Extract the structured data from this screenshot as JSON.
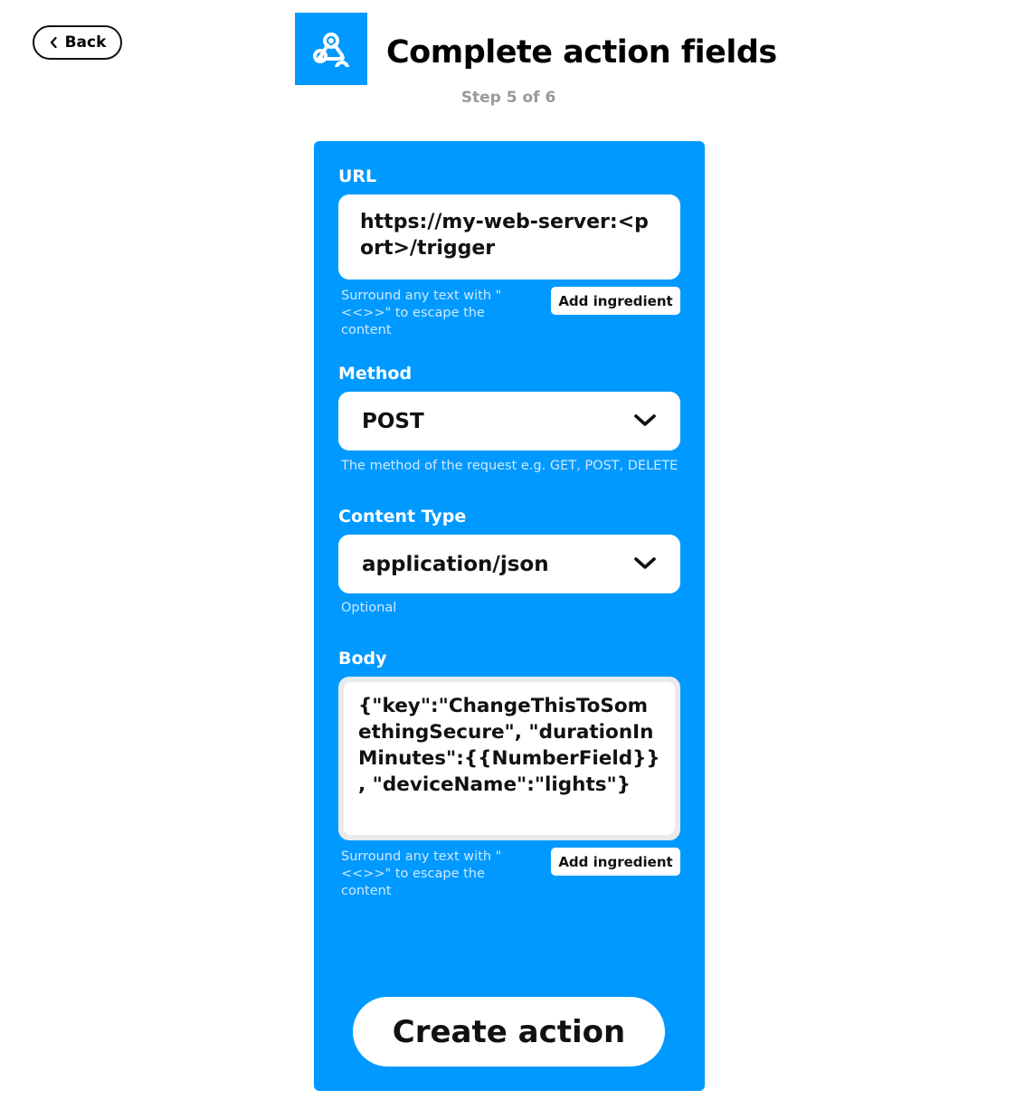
{
  "header": {
    "back_label": "Back",
    "title": "Complete action fields",
    "step": "Step 5 of 6",
    "logo_icon": "webhooks-icon",
    "brand_color": "#0099ff"
  },
  "form": {
    "url": {
      "label": "URL",
      "value": "https://my-web-server:<port>/trigger",
      "helper": "Surround any text with \"<<>>\" to escape the content",
      "ingredient_label": "Add ingredient"
    },
    "method": {
      "label": "Method",
      "value": "POST",
      "helper": "The method of the request e.g. GET, POST, DELETE"
    },
    "content_type": {
      "label": "Content Type",
      "value": "application/json",
      "helper": "Optional"
    },
    "body": {
      "label": "Body",
      "value": "{\"key\":\"ChangeThisToSomethingSecure\", \"durationInMinutes\":{{NumberField}} , \"deviceName\":\"lights\"}",
      "helper": "Surround any text with \"<<>>\" to escape the content",
      "ingredient_label": "Add ingredient"
    },
    "submit_label": "Create action"
  }
}
